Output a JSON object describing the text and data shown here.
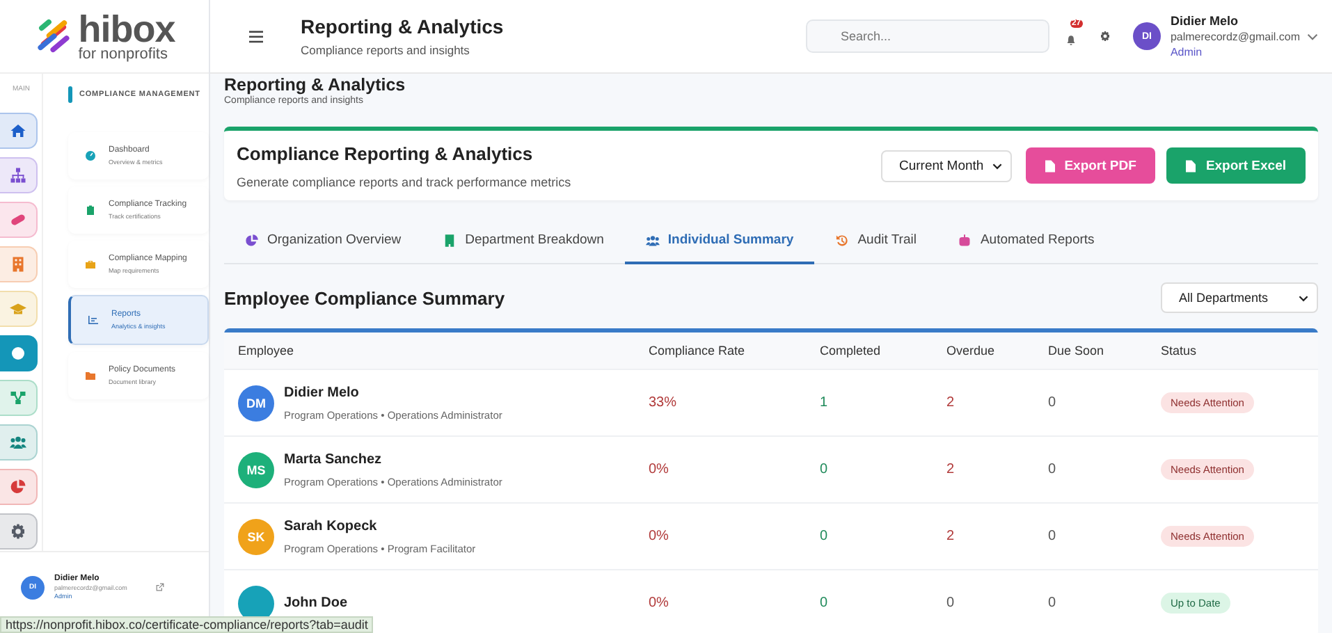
{
  "brand": {
    "name": "hibox",
    "tagline": "for nonprofits"
  },
  "rail": {
    "label": "MAIN",
    "items": [
      {
        "kind": "home",
        "color": "#1d5fc9",
        "selected": false
      },
      {
        "kind": "hierarchy",
        "color": "#7a4fd0",
        "selected": false
      },
      {
        "kind": "capsule",
        "color": "#e0457b",
        "selected": false
      },
      {
        "kind": "building",
        "color": "#e8762c",
        "selected": false
      },
      {
        "kind": "cap",
        "color": "#d9a21b",
        "selected": false
      },
      {
        "kind": "circle",
        "color": "#1496b8",
        "selected": true
      },
      {
        "kind": "network",
        "color": "#1aa36a",
        "selected": false
      },
      {
        "kind": "people",
        "color": "#13857f",
        "selected": false
      },
      {
        "kind": "pie",
        "color": "#d63a3a",
        "selected": false
      },
      {
        "kind": "gear",
        "color": "#555b66",
        "selected": false
      }
    ]
  },
  "sidebar": {
    "heading": "COMPLIANCE MANAGEMENT",
    "items": [
      {
        "kind": "gauge",
        "color": "#17a2b8",
        "label": "Dashboard",
        "sub": "Overview & metrics",
        "selected": false
      },
      {
        "kind": "clipboard",
        "color": "#1aa36a",
        "label": "Compliance Tracking",
        "sub": "Track certifications",
        "selected": false
      },
      {
        "kind": "briefcase",
        "color": "#e8a317",
        "label": "Compliance Mapping",
        "sub": "Map requirements",
        "selected": false
      },
      {
        "kind": "chart",
        "color": "#2f6db5",
        "label": "Reports",
        "sub": "Analytics & insights",
        "selected": true
      },
      {
        "kind": "folder",
        "color": "#e8762c",
        "label": "Policy Documents",
        "sub": "Document library",
        "selected": false
      }
    ],
    "user": {
      "initials": "DI",
      "name": "Didier Melo",
      "email": "palmerecordz@gmail.com",
      "role": "Admin"
    }
  },
  "header": {
    "title": "Reporting & Analytics",
    "subtitle": "Compliance reports and insights",
    "search": {
      "placeholder": "Search..."
    },
    "notifications": "27",
    "user": {
      "initials": "DI",
      "name": "Didier Melo",
      "email": "palmerecordz@gmail.com",
      "role": "Admin"
    }
  },
  "page": {
    "title": "Reporting & Analytics",
    "subtitle": "Compliance reports and insights"
  },
  "card": {
    "title": "Compliance Reporting & Analytics",
    "description": "Generate compliance reports and track performance metrics",
    "period": "Current Month",
    "buttons": [
      {
        "kind": "pdf",
        "label": "Export PDF"
      },
      {
        "kind": "excel",
        "label": "Export Excel"
      }
    ]
  },
  "tabs": [
    {
      "kind": "pie",
      "label": "Organization Overview",
      "selected": false
    },
    {
      "kind": "building",
      "label": "Department Breakdown",
      "selected": false
    },
    {
      "kind": "users",
      "label": "Individual Summary",
      "selected": true
    },
    {
      "kind": "history",
      "label": "Audit Trail",
      "selected": false
    },
    {
      "kind": "robot",
      "label": "Automated Reports",
      "selected": false
    }
  ],
  "section": {
    "title": "Employee Compliance Summary",
    "filter": "All Departments"
  },
  "table": {
    "columns": [
      "Employee",
      "Compliance Rate",
      "Completed",
      "Overdue",
      "Due Soon",
      "Status"
    ],
    "rows": [
      {
        "initials": "DM",
        "color": "#3b7de0",
        "name": "Didier Melo",
        "detail": "Program Operations • Operations Administrator",
        "rate": "33%",
        "completed": "1",
        "overdue": "2",
        "due_soon": "0",
        "status": "Needs Attention",
        "alert": true
      },
      {
        "initials": "MS",
        "color": "#1db07a",
        "name": "Marta Sanchez",
        "detail": "Program Operations • Operations Administrator",
        "rate": "0%",
        "completed": "0",
        "overdue": "2",
        "due_soon": "0",
        "status": "Needs Attention",
        "alert": true
      },
      {
        "initials": "SK",
        "color": "#f0a21a",
        "name": "Sarah Kopeck",
        "detail": "Program Operations • Program Facilitator",
        "rate": "0%",
        "completed": "0",
        "overdue": "2",
        "due_soon": "0",
        "status": "Needs Attention",
        "alert": true
      },
      {
        "color": "#17a2b8",
        "name": "John Doe",
        "rate": "0%",
        "completed": "0",
        "overdue": "0",
        "due_soon": "0",
        "status": "Up to Date",
        "alert": false
      }
    ]
  },
  "status_url": "https://nonprofit.hibox.co/certificate-compliance/reports?tab=audit"
}
